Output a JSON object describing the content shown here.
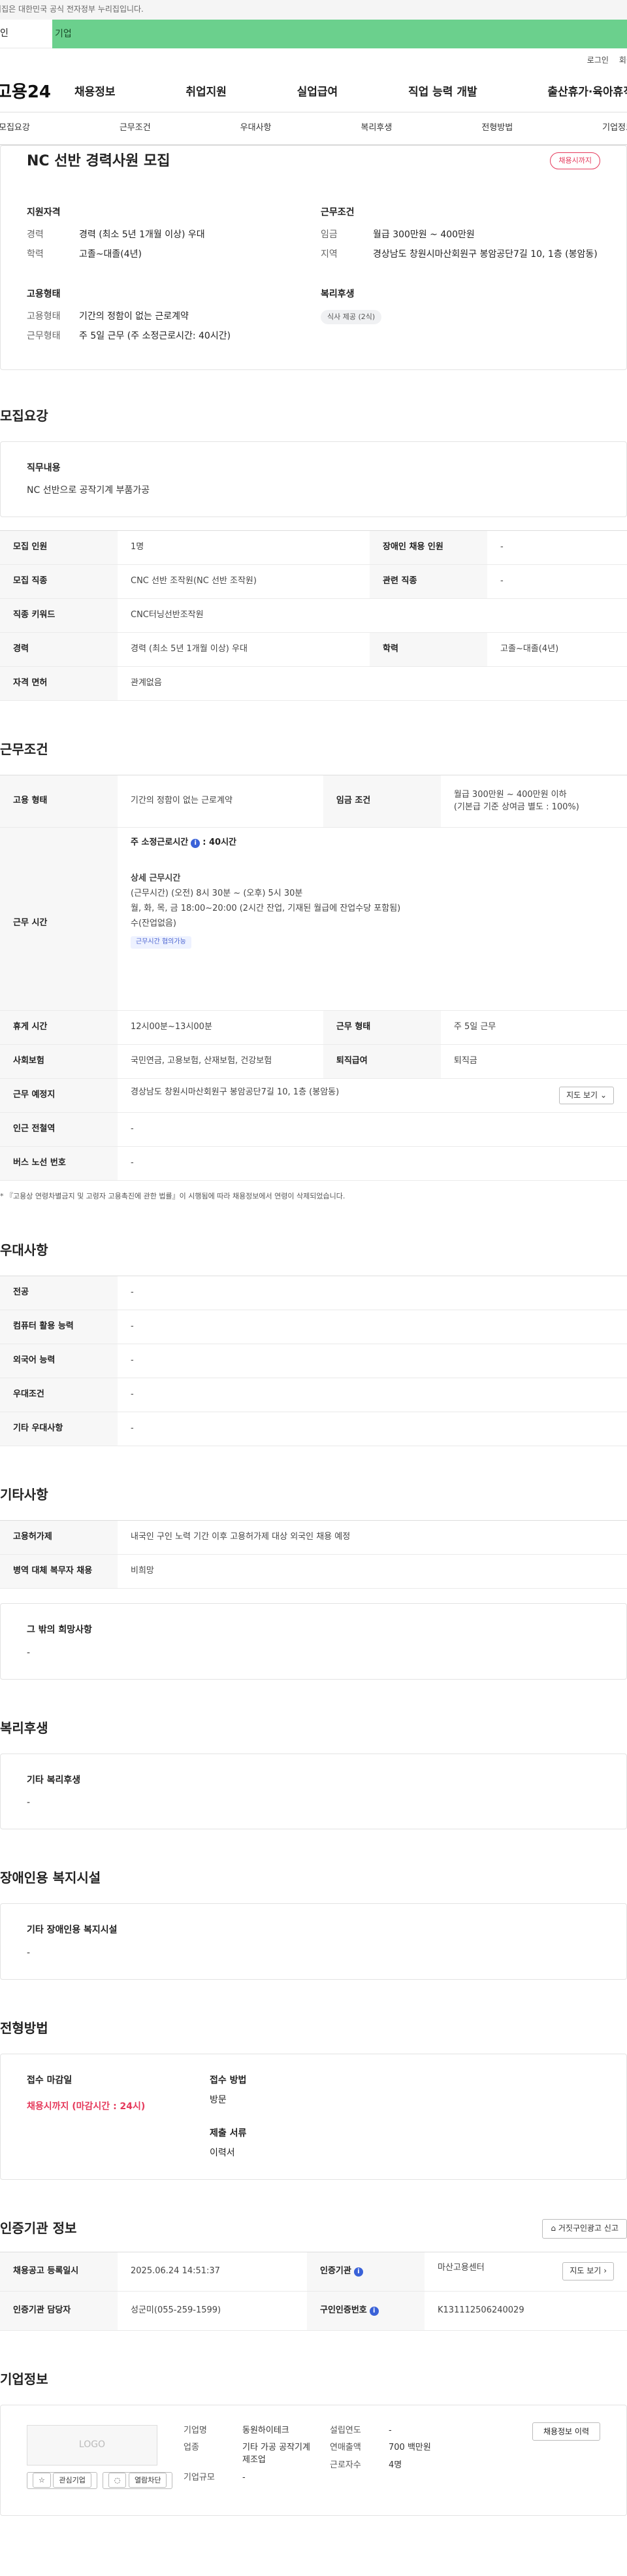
{
  "banner": {
    "text": "누리집은 대한민국 공식 전자정부 누리집입니다."
  },
  "user_tabs": {
    "individual": "인",
    "enterprise": "기업"
  },
  "util": {
    "login": "로그인",
    "signup": "회원"
  },
  "logo": "고용24",
  "gnb": [
    "채용정보",
    "취업지원",
    "실업급여",
    "직업 능력 개발",
    "출산휴가·육아휴직"
  ],
  "subnav": [
    "모집요강",
    "근무조건",
    "우대사항",
    "복리후생",
    "전형방법",
    "기업정보"
  ],
  "summary": {
    "title": "NC 선반 경력사원 모집",
    "status": "채용시까지",
    "qualification": {
      "heading": "지원자격",
      "career_k": "경력",
      "career_v": "경력 (최소 5년 1개월 이상) 우대",
      "edu_k": "학력",
      "edu_v": "고졸~대졸(4년)"
    },
    "conditions": {
      "heading": "근무조건",
      "wage_k": "임금",
      "wage_v": "월급 300만원 ~ 400만원",
      "area_k": "지역",
      "area_v": "경상남도 창원시마산회원구 봉암공단7길 10, 1층 (봉암동)"
    },
    "employment": {
      "heading": "고용형태",
      "type_k": "고용형태",
      "type_v": "기간의 정함이 없는 근로계약",
      "form_k": "근무형태",
      "form_v": "주 5일 근무 (주 소정근로시간: 40시간)"
    },
    "welfare": {
      "heading": "복리후생",
      "tag": "식사 제공 (2식)"
    }
  },
  "recruit": {
    "title": "모집요강",
    "duty_label": "직무내용",
    "duty_text": "NC 선반으로 공작기계 부품가공",
    "rows": [
      {
        "k1": "모집 인원",
        "v1": "1명",
        "k2": "장애인 채용 인원",
        "v2": "-"
      },
      {
        "k1": "모집 직종",
        "v1": "CNC 선반 조작원(NC 선반 조작원)",
        "k2": "관련 직종",
        "v2": "-"
      },
      {
        "k1": "직종 키워드",
        "v1": "CNC터닝선반조작원"
      },
      {
        "k1": "경력",
        "v1": "경력 (최소 5년 1개월 이상) 우대",
        "k2": "학력",
        "v2": "고졸~대졸(4년)"
      },
      {
        "k1": "자격 면허",
        "v1": "관계없음"
      }
    ]
  },
  "work": {
    "title": "근무조건",
    "emp_k": "고용 형태",
    "emp_v": "기간의 정함이 없는 근로계약",
    "wage_k": "임금 조건",
    "wage_v1": "월급 300만원 ~ 400만원 이하",
    "wage_v2": "(기본급 기준 상여금 별도 : 100%)",
    "hours_k": "근무 시간",
    "weekly": "주 소정근로시간",
    "weekly_info": "i",
    "weekly_v": ": 40시간",
    "detail_title": "상세 근무시간",
    "detail_l1": "(근무시간) (오전) 8시 30분 ~ (오후) 5시 30분",
    "detail_l2": "월, 화, 목, 금 18:00~20:00 (2시간 잔업, 기재된 월급에 잔업수당 포함됨)",
    "detail_l3": "수(잔업없음)",
    "detail_chip": "근무시간 협의가능",
    "break_k": "휴게 시간",
    "break_v": "12시00분~13시00분",
    "form_k": "근무 형태",
    "form_v": "주 5일 근무",
    "ins_k": "사회보험",
    "ins_v": "국민연금, 고용보험, 산재보험, 건강보험",
    "sev_k": "퇴직급여",
    "sev_v": "퇴직금",
    "place_k": "근무 예정지",
    "place_v": "경상남도 창원시마산회원구 봉암공단7길 10, 1층 (봉암동)",
    "map_btn": "지도 보기",
    "subway_k": "인근 전철역",
    "subway_v": "-",
    "bus_k": "버스 노선 번호",
    "bus_v": "-",
    "footnote": "* 『고용상 연령차별금지 및 고령자 고용촉진에 관한 법률』이 시행됨에 따라 채용정보에서 연령이 삭제되었습니다."
  },
  "pref": {
    "title": "우대사항",
    "rows": [
      {
        "k": "전공",
        "v": "-"
      },
      {
        "k": "컴퓨터 활용 능력",
        "v": "-"
      },
      {
        "k": "외국어 능력",
        "v": "-"
      },
      {
        "k": "우대조건",
        "v": "-"
      },
      {
        "k": "기타 우대사항",
        "v": "-"
      }
    ]
  },
  "etc": {
    "title": "기타사항",
    "rows": [
      {
        "k": "고용허가제",
        "v": "내국인 구인 노력 기간 이후 고용허가제 대상 외국인 채용 예정"
      },
      {
        "k": "병역 대체 복무자 채용",
        "v": "비희망"
      }
    ],
    "other_label": "그 밖의 희망사항",
    "other_v": "-"
  },
  "welfare": {
    "title": "복리후생",
    "label": "기타 복리후생",
    "v": "-"
  },
  "disability": {
    "title": "장애인용 복지시설",
    "label": "기타 장애인용 복지시설",
    "v": "-"
  },
  "apply": {
    "title": "전형방법",
    "deadline_label": "접수 마감일",
    "deadline_v": "채용시까지 (마감시간 : 24시)",
    "method_label": "접수 방법",
    "method_v": "방문",
    "docs_label": "제출 서류",
    "docs_v": "이력서"
  },
  "cert": {
    "title": "인증기관 정보",
    "report_btn": "거짓구인광고 신고",
    "reg_k": "채용공고 등록일시",
    "reg_v": "2025.06.24 14:51:37",
    "org_k": "인증기관",
    "org_v": "마산고용센터",
    "map_btn": "지도 보기",
    "mgr_k": "인증기관 담당자",
    "mgr_v": "성군미(055-259-1599)",
    "no_k": "구인인증번호",
    "no_v": "K131112506240029"
  },
  "company": {
    "title": "기업정보",
    "logo_ph": "LOGO",
    "fav_btn": "관심기업",
    "block_btn": "열람차단",
    "name_k": "기업명",
    "name_v": "동원하이테크",
    "ind_k": "업종",
    "ind_v": "기타 가공 공작기계 제조업",
    "size_k": "기업규모",
    "size_v": "-",
    "est_k": "설립연도",
    "est_v": "-",
    "sales_k": "연매출액",
    "sales_v": "700 백만원",
    "emp_k": "근로자수",
    "emp_v": "4명",
    "history_btn": "채용정보 이력"
  }
}
